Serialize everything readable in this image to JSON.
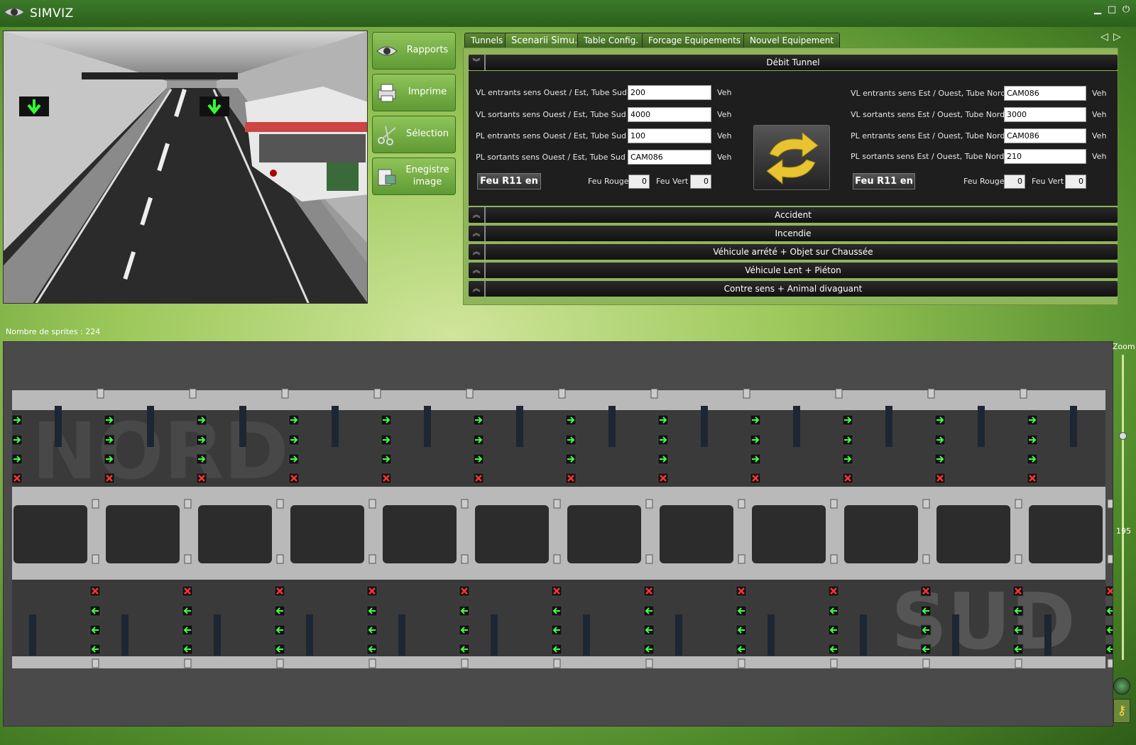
{
  "app": {
    "title": "SIMVIZ",
    "window_controls": [
      "minimize-icon",
      "maximize-icon",
      "power-icon"
    ]
  },
  "side_buttons": [
    {
      "label": "Rapports",
      "icon": "eye-icon"
    },
    {
      "label": "Imprime",
      "icon": "printer-icon"
    },
    {
      "label": "Sélection",
      "icon": "scissors-icon"
    },
    {
      "label": "Enegistre image",
      "icon": "camera-icon"
    }
  ],
  "tabs": [
    "Tunnels",
    "Scenarii Simu.",
    "Table Config.",
    "Forcage Equipements",
    "Nouvel Equipement"
  ],
  "active_tab": "Scenarii Simu.",
  "sections": {
    "debit": "Débit Tunnel",
    "collapsed": [
      "Accident",
      "Incendie",
      "Véhicule arrété + Objet sur Chaussée",
      "Véhicule Lent + Piéton",
      "Contre sens + Animal divaguant"
    ]
  },
  "debit_left": [
    {
      "label": "VL entrants sens Ouest / Est, Tube Sud",
      "value": "200",
      "unit": "Veh"
    },
    {
      "label": "VL sortants sens Ouest / Est, Tube Sud",
      "value": "4000",
      "unit": "Veh"
    },
    {
      "label": "PL entrants sens Ouest / Est, Tube Sud",
      "value": "100",
      "unit": "Veh"
    },
    {
      "label": "PL sortants sens Ouest / Est, Tube Sud",
      "value": "CAM086",
      "unit": "Veh"
    }
  ],
  "debit_right": [
    {
      "label": "VL entrants sens Est / Ouest, Tube Nord",
      "value": "CAM086",
      "unit": "Veh"
    },
    {
      "label": "VL sortants sens Est / Ouest, Tube Nord",
      "value": "3000",
      "unit": "Veh"
    },
    {
      "label": "PL entrants sens Est / Ouest, Tube Nord",
      "value": "CAM086",
      "unit": "Veh"
    },
    {
      "label": "PL sortants sens Est / Ouest, Tube Nord",
      "value": "210",
      "unit": "Veh"
    }
  ],
  "feu": {
    "button": "Feu R11 en",
    "rouge_label": "Feu Rouge",
    "vert_label": "Feu Vert",
    "left_rouge": "0",
    "left_vert": "0",
    "right_rouge": "0",
    "right_vert": "0"
  },
  "map": {
    "sprites": "Nombre de sprites : 224",
    "zoom_label": "Zoom",
    "zoom_value": "195",
    "north_label": "NORD",
    "south_label": "SUD"
  }
}
